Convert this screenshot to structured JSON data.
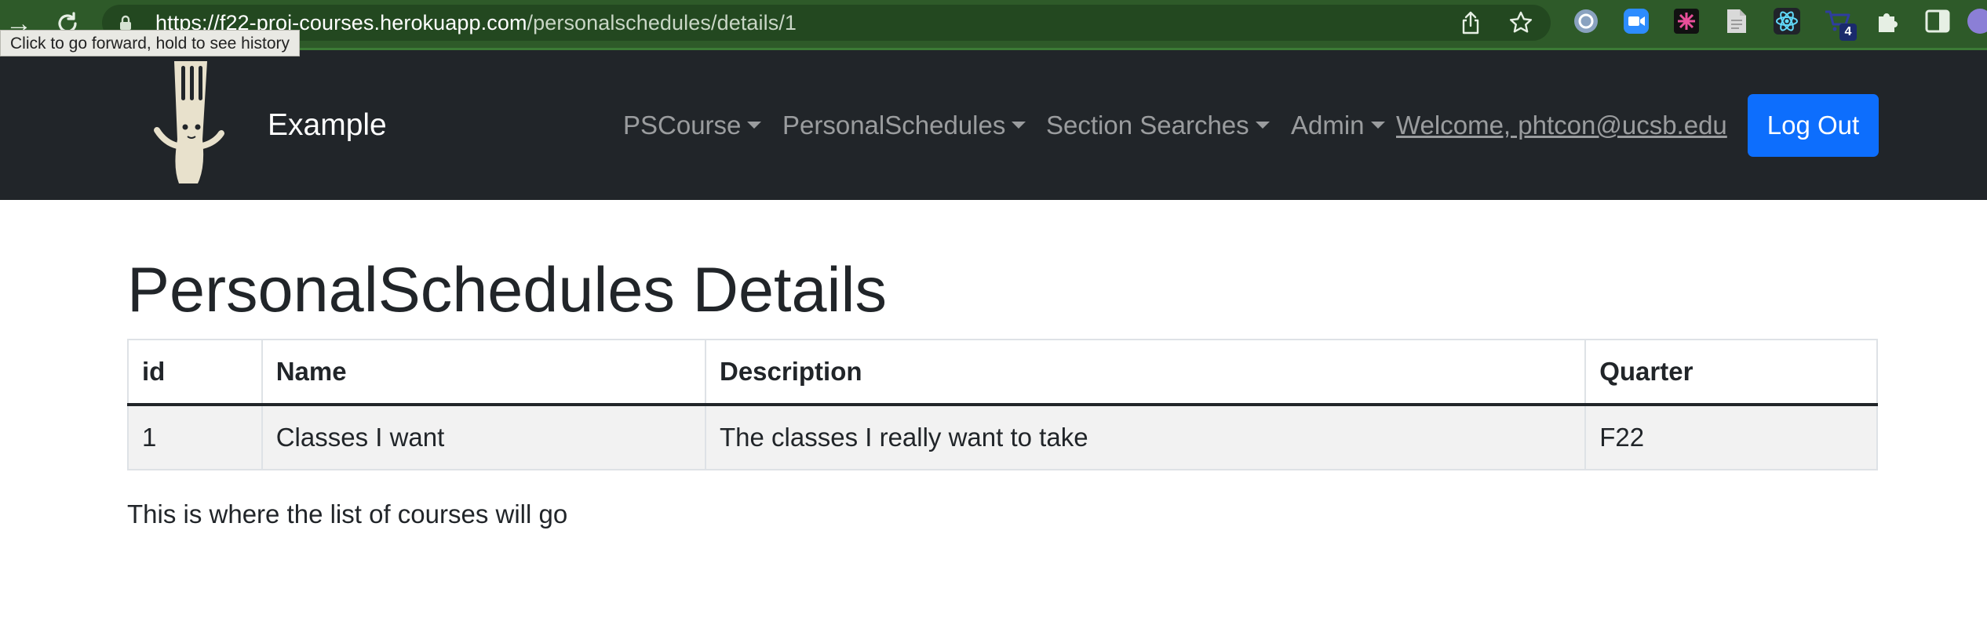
{
  "browser": {
    "url_host": "https://f22-proj-courses.herokuapp.com",
    "url_path": "/personalschedules/details/1",
    "tooltip": "Click to go forward, hold to see history",
    "cart_badge": "4"
  },
  "navbar": {
    "brand": "Example",
    "menus": [
      "PSCourse",
      "PersonalSchedules",
      "Section Searches",
      "Admin"
    ],
    "welcome": "Welcome, phtcon@ucsb.edu",
    "logout": "Log Out",
    "logout_color": "#0d6efd",
    "background": "#212529"
  },
  "page": {
    "title": "PersonalSchedules Details",
    "table": {
      "headers": [
        "id",
        "Name",
        "Description",
        "Quarter"
      ],
      "rows": [
        [
          "1",
          "Classes I want",
          "The classes I really want to take",
          "F22"
        ]
      ]
    },
    "note": "This is where the list of courses will go"
  }
}
